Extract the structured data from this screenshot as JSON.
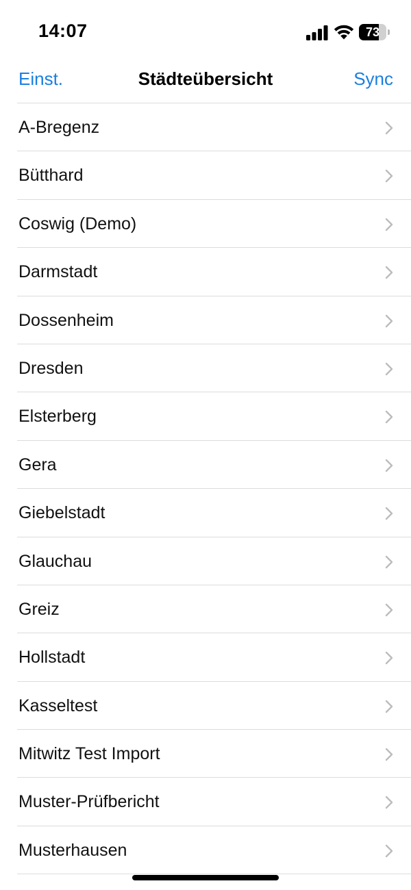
{
  "status_bar": {
    "time": "14:07",
    "battery_level": "73",
    "battery_fraction": 0.73,
    "icons": [
      "signal-icon",
      "wifi-icon",
      "battery-icon"
    ]
  },
  "nav": {
    "left_label": "Einst.",
    "title": "Städteübersicht",
    "right_label": "Sync",
    "accent_color": "#1a7fe0"
  },
  "cities": [
    {
      "name": "A-Bregenz"
    },
    {
      "name": "Bütthard"
    },
    {
      "name": "Coswig (Demo)"
    },
    {
      "name": "Darmstadt"
    },
    {
      "name": "Dossenheim"
    },
    {
      "name": "Dresden"
    },
    {
      "name": "Elsterberg"
    },
    {
      "name": "Gera"
    },
    {
      "name": "Giebelstadt"
    },
    {
      "name": "Glauchau"
    },
    {
      "name": "Greiz"
    },
    {
      "name": "Hollstadt"
    },
    {
      "name": "Kasseltest"
    },
    {
      "name": "Mitwitz Test Import"
    },
    {
      "name": "Muster-Prüfbericht"
    },
    {
      "name": "Musterhausen"
    }
  ]
}
